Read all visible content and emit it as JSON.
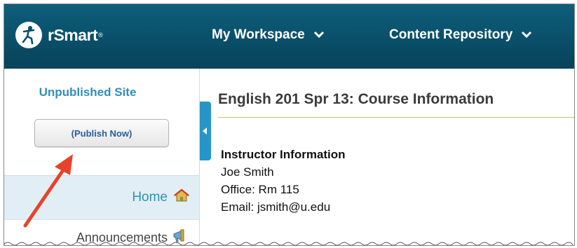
{
  "header": {
    "brand": "rSmart",
    "brand_mark": "®",
    "nav": [
      {
        "label": "My Workspace"
      },
      {
        "label": "Content Repository"
      }
    ]
  },
  "sidebar": {
    "status_text": "Unpublished Site",
    "publish_button": "(Publish Now)",
    "items": [
      {
        "label": "Home",
        "icon": "home-icon",
        "selected": true
      },
      {
        "label": "Announcements",
        "icon": "megaphone-icon"
      }
    ]
  },
  "content": {
    "title": "English 201 Spr 13: Course Information",
    "instructor": {
      "heading": "Instructor Information",
      "name": "Joe Smith",
      "office": "Office: Rm 115",
      "email": "Email: jsmith@u.edu"
    }
  },
  "colors": {
    "header_bg": "#0a4f69",
    "accent": "#2f8fb5",
    "annotation_arrow": "#e8422a"
  }
}
